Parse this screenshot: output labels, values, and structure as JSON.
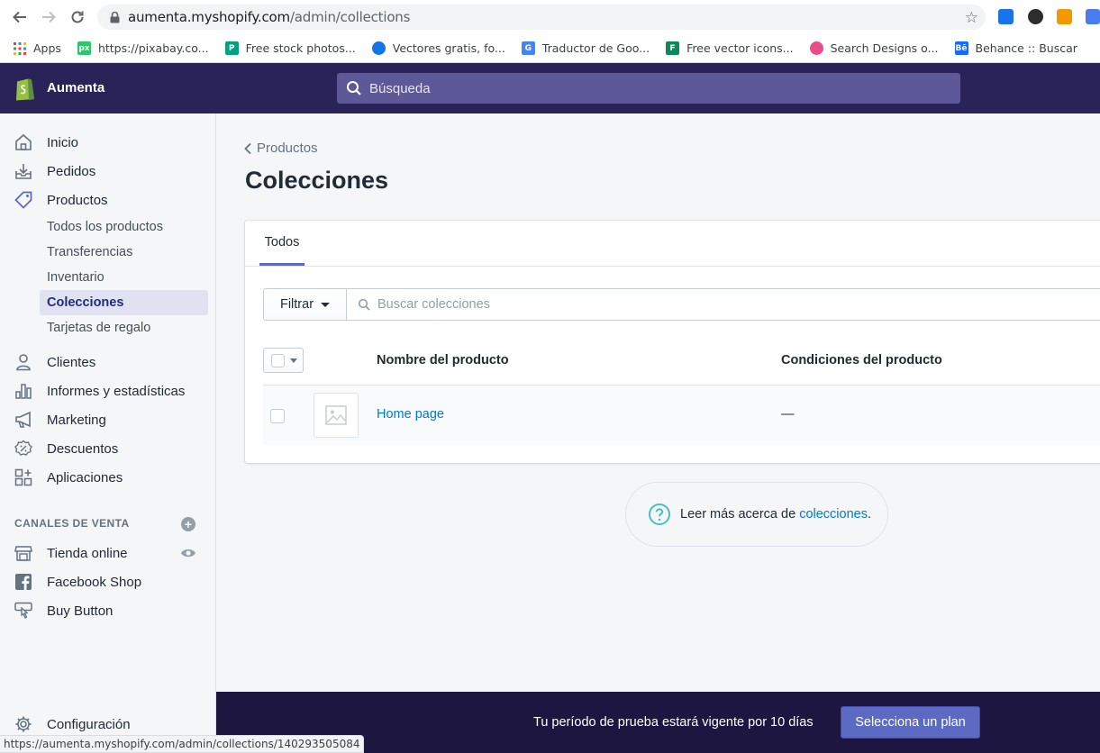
{
  "browser": {
    "url_host": "aumenta.myshopify.com",
    "url_path": "/admin/collections",
    "status_url": "https://aumenta.myshopify.com/admin/collections/140293505084",
    "bookmarks": [
      {
        "label": "Apps",
        "icon": "apps-grid-icon",
        "color": "#e8453c"
      },
      {
        "label": "https://pixabay.co...",
        "icon": "pixabay-icon",
        "color": "#2ec66d"
      },
      {
        "label": "Free stock photos...",
        "icon": "pexels-icon",
        "color": "#05a081"
      },
      {
        "label": "Vectores gratis, fo...",
        "icon": "freepik-icon",
        "color": "#1273eb"
      },
      {
        "label": "Traductor de Goo...",
        "icon": "google-translate-icon",
        "color": "#4285f4"
      },
      {
        "label": "Free vector icons...",
        "icon": "flaticon-icon",
        "color": "#0a8a5c"
      },
      {
        "label": "Search Designs o...",
        "icon": "dribbble-icon",
        "color": "#ea4c89"
      },
      {
        "label": "Behance :: Buscar",
        "icon": "behance-icon",
        "color": "#1769ff"
      }
    ]
  },
  "topbar": {
    "store_name": "Aumenta",
    "search_placeholder": "Búsqueda"
  },
  "sidebar": {
    "items": [
      {
        "label": "Inicio",
        "icon": "home-icon"
      },
      {
        "label": "Pedidos",
        "icon": "orders-icon"
      },
      {
        "label": "Productos",
        "icon": "tag-icon"
      },
      {
        "label": "Clientes",
        "icon": "customer-icon"
      },
      {
        "label": "Informes y estadísticas",
        "icon": "analytics-icon"
      },
      {
        "label": "Marketing",
        "icon": "megaphone-icon"
      },
      {
        "label": "Descuentos",
        "icon": "discount-icon"
      },
      {
        "label": "Aplicaciones",
        "icon": "apps-icon"
      }
    ],
    "product_subitems": [
      {
        "label": "Todos los productos"
      },
      {
        "label": "Transferencias"
      },
      {
        "label": "Inventario"
      },
      {
        "label": "Colecciones"
      },
      {
        "label": "Tarjetas de regalo"
      }
    ],
    "sales_channels_heading": "CANALES DE VENTA",
    "channels": [
      {
        "label": "Tienda online",
        "icon": "store-icon"
      },
      {
        "label": "Facebook Shop",
        "icon": "facebook-icon"
      },
      {
        "label": "Buy Button",
        "icon": "buy-button-icon"
      }
    ],
    "settings_label": "Configuración"
  },
  "main": {
    "breadcrumb": "Productos",
    "title": "Colecciones",
    "tab_label": "Todos",
    "filter_label": "Filtrar",
    "filter_search_placeholder": "Buscar colecciones",
    "columns": [
      "Nombre del producto",
      "Condiciones del producto"
    ],
    "rows": [
      {
        "name": "Home page",
        "conditions": "—"
      }
    ],
    "learn_prefix": "Leer más acerca de ",
    "learn_link": "colecciones",
    "learn_suffix": "."
  },
  "trial": {
    "text": "Tu período de prueba estará vigente por 10 días",
    "button": "Selecciona un plan"
  },
  "colors": {
    "topbar": "#2a2357",
    "accent": "#5c6ac4",
    "link": "#007ace",
    "trial_bar": "#1c1640"
  }
}
